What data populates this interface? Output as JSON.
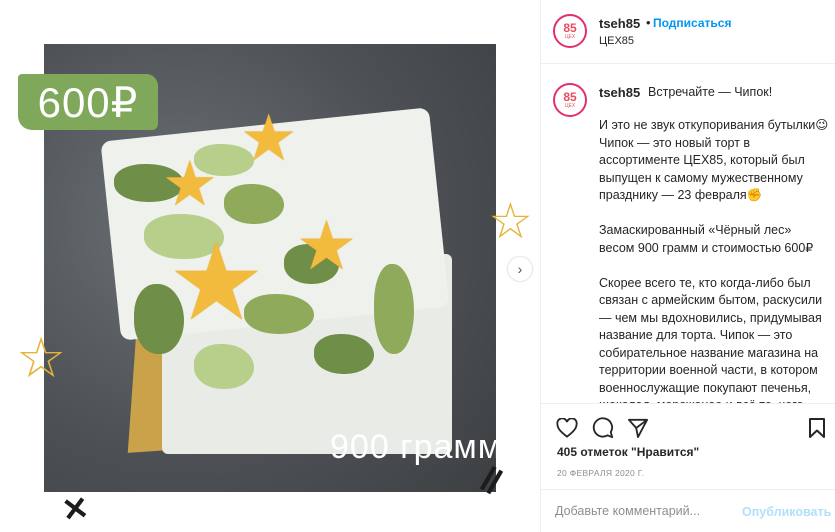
{
  "media": {
    "price_label": "600₽",
    "weight_label": "900 грамм",
    "next_icon": "chevron-right-icon"
  },
  "header": {
    "avatar_text": "85",
    "avatar_sub": "ЦЕХ",
    "username": "tseh85",
    "separator": "•",
    "follow_label": "Подписаться",
    "subtitle": "ЦЕХ85"
  },
  "caption": {
    "username": "tseh85",
    "first_line": "Встречайте — Чипок!",
    "paragraphs": [
      "И это не звук откупоривания бутылки😉 Чипок — это новый торт в ассортименте ЦЕХ85, который был выпущен к самому мужественному празднику — 23 февраля✊",
      "Замаскированный «Чёрный лес» весом 900 грамм и стоимостью 600₽",
      "Скорее всего те, кто когда-либо был связан с армейским бытом, раскусили — чем мы вдохновились, придумывая название для торта. Чипок — это собирательное название магазина на территории военной части, в котором военнослужащие покупают печенья, шоколад, мороженое и всё то, чего"
    ]
  },
  "actions": {
    "icons": [
      "heart-icon",
      "comment-icon",
      "share-icon",
      "bookmark-icon"
    ],
    "likes": "405 отметок \"Нравится\"",
    "date": "20 ФЕВРАЛЯ 2020 Г."
  },
  "comment": {
    "placeholder": "Добавьте комментарий...",
    "publish_label": "Опубликовать"
  },
  "colors": {
    "accent": "#0095f6",
    "price_tag": "#7fa85a",
    "avatar_ring": "#e1306c",
    "star": "#f3bb3d"
  }
}
